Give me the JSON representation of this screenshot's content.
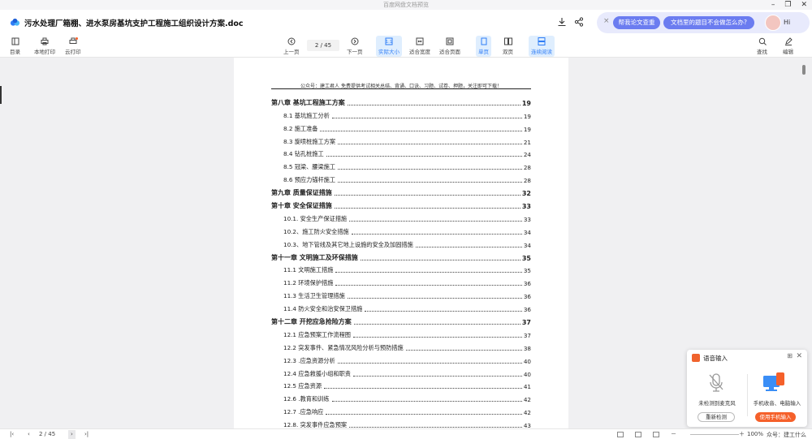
{
  "window": {
    "title": "百度网盘文档预览"
  },
  "header": {
    "doc_title": "污水处理厂箱棚、进水泵房基坑支护工程施工组织设计方案.doc"
  },
  "ai_bar": {
    "close": "×",
    "pill1": "帮我论文查重",
    "pill2": "文档里的题目不会做怎么办?",
    "greeting": "Hi"
  },
  "toolbar": {
    "catalog": "目录",
    "local_print": "本地打印",
    "cloud_print": "云打印",
    "prev": "上一页",
    "page_indicator": "2 / 45",
    "next": "下一页",
    "actual_size": "实际大小",
    "fit_width": "适合宽度",
    "fit_page": "适合页面",
    "single": "单页",
    "double": "双页",
    "continuous": "连续阅读",
    "search": "查找",
    "edit": "编辑"
  },
  "page": {
    "header_text": "公众号：建工君人 免费提供考试相关总结、背诵、口诀、习题、试卷、押题，关注即可下载！",
    "toc": [
      {
        "label": "第八章  基坑工程施工方案",
        "page": "19",
        "level": "ch"
      },
      {
        "label": "8.1 基坑施工分析",
        "page": "19",
        "level": "sub"
      },
      {
        "label": "8.2 施工准备",
        "page": "19",
        "level": "sub"
      },
      {
        "label": "8.3 旋喷桩施工方案",
        "page": "21",
        "level": "sub"
      },
      {
        "label": "8.4 钻孔桩施工",
        "page": "24",
        "level": "sub"
      },
      {
        "label": "8.5  冠梁、腰梁施工",
        "page": "28",
        "level": "sub"
      },
      {
        "label": "8.6  预应力锚杆施工",
        "page": "28",
        "level": "sub"
      },
      {
        "label": "第九章  质量保证措施",
        "page": "32",
        "level": "ch"
      },
      {
        "label": "第十章  安全保证措施",
        "page": "33",
        "level": "ch"
      },
      {
        "label": "10.1. 安全生产保证措施",
        "page": "33",
        "level": "sub"
      },
      {
        "label": "10.2、施工防火安全措施",
        "page": "34",
        "level": "sub"
      },
      {
        "label": "10.3、地下管线及其它地上设施的安全及加固措施",
        "page": "34",
        "level": "sub"
      },
      {
        "label": "第十一章  文明施工及环保措施",
        "page": "35",
        "level": "ch"
      },
      {
        "label": "11.1 文明施工措施",
        "page": "35",
        "level": "sub"
      },
      {
        "label": "11.2 环境保护措施",
        "page": "36",
        "level": "sub"
      },
      {
        "label": "11.3 生活卫生管理措施",
        "page": "36",
        "level": "sub"
      },
      {
        "label": "11.4 防火安全和治安保卫措施",
        "page": "36",
        "level": "sub"
      },
      {
        "label": "第十二章  开挖应急抢险方案",
        "page": "37",
        "level": "ch"
      },
      {
        "label": "12.1 应急预案工作流程图",
        "page": "37",
        "level": "sub"
      },
      {
        "label": "12.2 突发事件、紧急情况风险分析与预防措施",
        "page": "38",
        "level": "sub"
      },
      {
        "label": "12.3 .应急资源分析",
        "page": "40",
        "level": "sub"
      },
      {
        "label": "12.4 应急救援小组和职责",
        "page": "40",
        "level": "sub"
      },
      {
        "label": "12.5 应急资源",
        "page": "41",
        "level": "sub"
      },
      {
        "label": "12.6 .教育和训练",
        "page": "42",
        "level": "sub"
      },
      {
        "label": "12.7 .应急响应",
        "page": "42",
        "level": "sub"
      },
      {
        "label": "12.8. 突发事件应急预案",
        "page": "43",
        "level": "sub"
      }
    ]
  },
  "voice_panel": {
    "title": "语音输入",
    "left_label": "未检测到麦克风",
    "right_label": "手机收音、电脑输入",
    "btn_recheck": "重新检测",
    "btn_use_phone": "使用手机输入"
  },
  "statusbar": {
    "page_indicator": "2 / 45",
    "zoom": "100%",
    "watermark": "众号：建工什么"
  },
  "colors": {
    "accent": "#2f7df6",
    "ai_pill": "#6b7cf0",
    "voice_orange": "#f5602a"
  }
}
